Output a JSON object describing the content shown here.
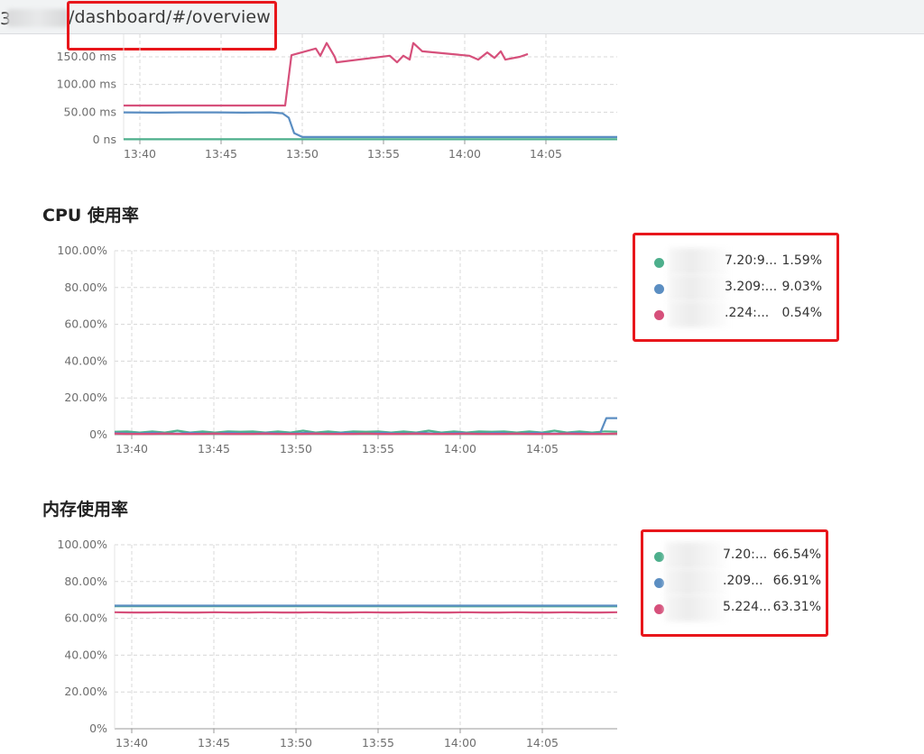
{
  "browser": {
    "url_prefix": "3",
    "url": "/dashboard/#/overview"
  },
  "colors": {
    "green": "#4daf8c",
    "blue": "#5b8ec2",
    "pink": "#d6507b",
    "highlight": "#e8161b",
    "grid": "#d8d8d8"
  },
  "latency_chart": {
    "y_ticks": [
      "150.00 ms",
      "100.00 ms",
      "50.00 ms",
      "0 ns"
    ],
    "x_ticks": [
      "13:40",
      "13:45",
      "13:50",
      "13:55",
      "14:00",
      "14:05"
    ]
  },
  "cpu_section": {
    "title": "CPU 使用率",
    "y_ticks": [
      "100.00%",
      "80.00%",
      "60.00%",
      "40.00%",
      "20.00%",
      "0%"
    ],
    "x_ticks": [
      "13:40",
      "13:45",
      "13:50",
      "13:55",
      "14:00",
      "14:05"
    ],
    "legend": [
      {
        "name": "7.20:9...",
        "value": "1.59%",
        "color": "#4daf8c"
      },
      {
        "name": "3.209:...",
        "value": "9.03%",
        "color": "#5b8ec2"
      },
      {
        "name": ".224:...",
        "value": "0.54%",
        "color": "#d6507b"
      }
    ]
  },
  "memory_section": {
    "title": "内存使用率",
    "y_ticks": [
      "100.00%",
      "80.00%",
      "60.00%",
      "40.00%",
      "20.00%",
      "0%"
    ],
    "x_ticks": [
      "13:40",
      "13:45",
      "13:50",
      "13:55",
      "14:00",
      "14:05"
    ],
    "legend": [
      {
        "name": "7.20:...",
        "value": "66.54%",
        "color": "#4daf8c"
      },
      {
        "name": ".209...",
        "value": "66.91%",
        "color": "#5b8ec2"
      },
      {
        "name": "5.224...",
        "value": "63.31%",
        "color": "#d6507b"
      }
    ]
  },
  "chart_data": [
    {
      "type": "line",
      "title": "",
      "x": [
        "13:40",
        "13:45",
        "13:50",
        "13:55",
        "14:00",
        "14:05"
      ],
      "ylim": [
        0,
        150
      ],
      "yunit": "ms",
      "series": [
        {
          "values": [
            63,
            63,
            63,
            155,
            160,
            165
          ]
        },
        {
          "values": [
            49,
            49,
            49,
            5,
            5,
            5
          ]
        },
        {
          "values": [
            1,
            1,
            1,
            1,
            1,
            1
          ]
        }
      ]
    },
    {
      "type": "line",
      "title": "CPU 使用率",
      "x": [
        "13:40",
        "13:45",
        "13:50",
        "13:55",
        "14:00",
        "14:05"
      ],
      "ylim": [
        0,
        100
      ],
      "series": [
        {
          "name": "7.20:9...",
          "values": [
            1.2,
            1.5,
            1.6,
            1.4,
            1.5,
            1.59
          ]
        },
        {
          "name": "3.209:...",
          "values": [
            0.8,
            0.7,
            0.8,
            0.6,
            0.7,
            9.03
          ]
        },
        {
          "name": ".224:...",
          "values": [
            0.5,
            0.5,
            0.6,
            0.5,
            0.5,
            0.54
          ]
        }
      ]
    },
    {
      "type": "line",
      "title": "内存使用率",
      "x": [
        "13:40",
        "13:45",
        "13:50",
        "13:55",
        "14:00",
        "14:05"
      ],
      "ylim": [
        0,
        100
      ],
      "series": [
        {
          "name": "7.20:...",
          "values": [
            66.5,
            66.5,
            66.5,
            66.5,
            66.5,
            66.54
          ]
        },
        {
          "name": ".209...",
          "values": [
            66.9,
            66.9,
            66.9,
            66.9,
            66.9,
            66.91
          ]
        },
        {
          "name": "5.224...",
          "values": [
            63.3,
            63.3,
            63.3,
            63.3,
            63.3,
            63.31
          ]
        }
      ]
    }
  ]
}
